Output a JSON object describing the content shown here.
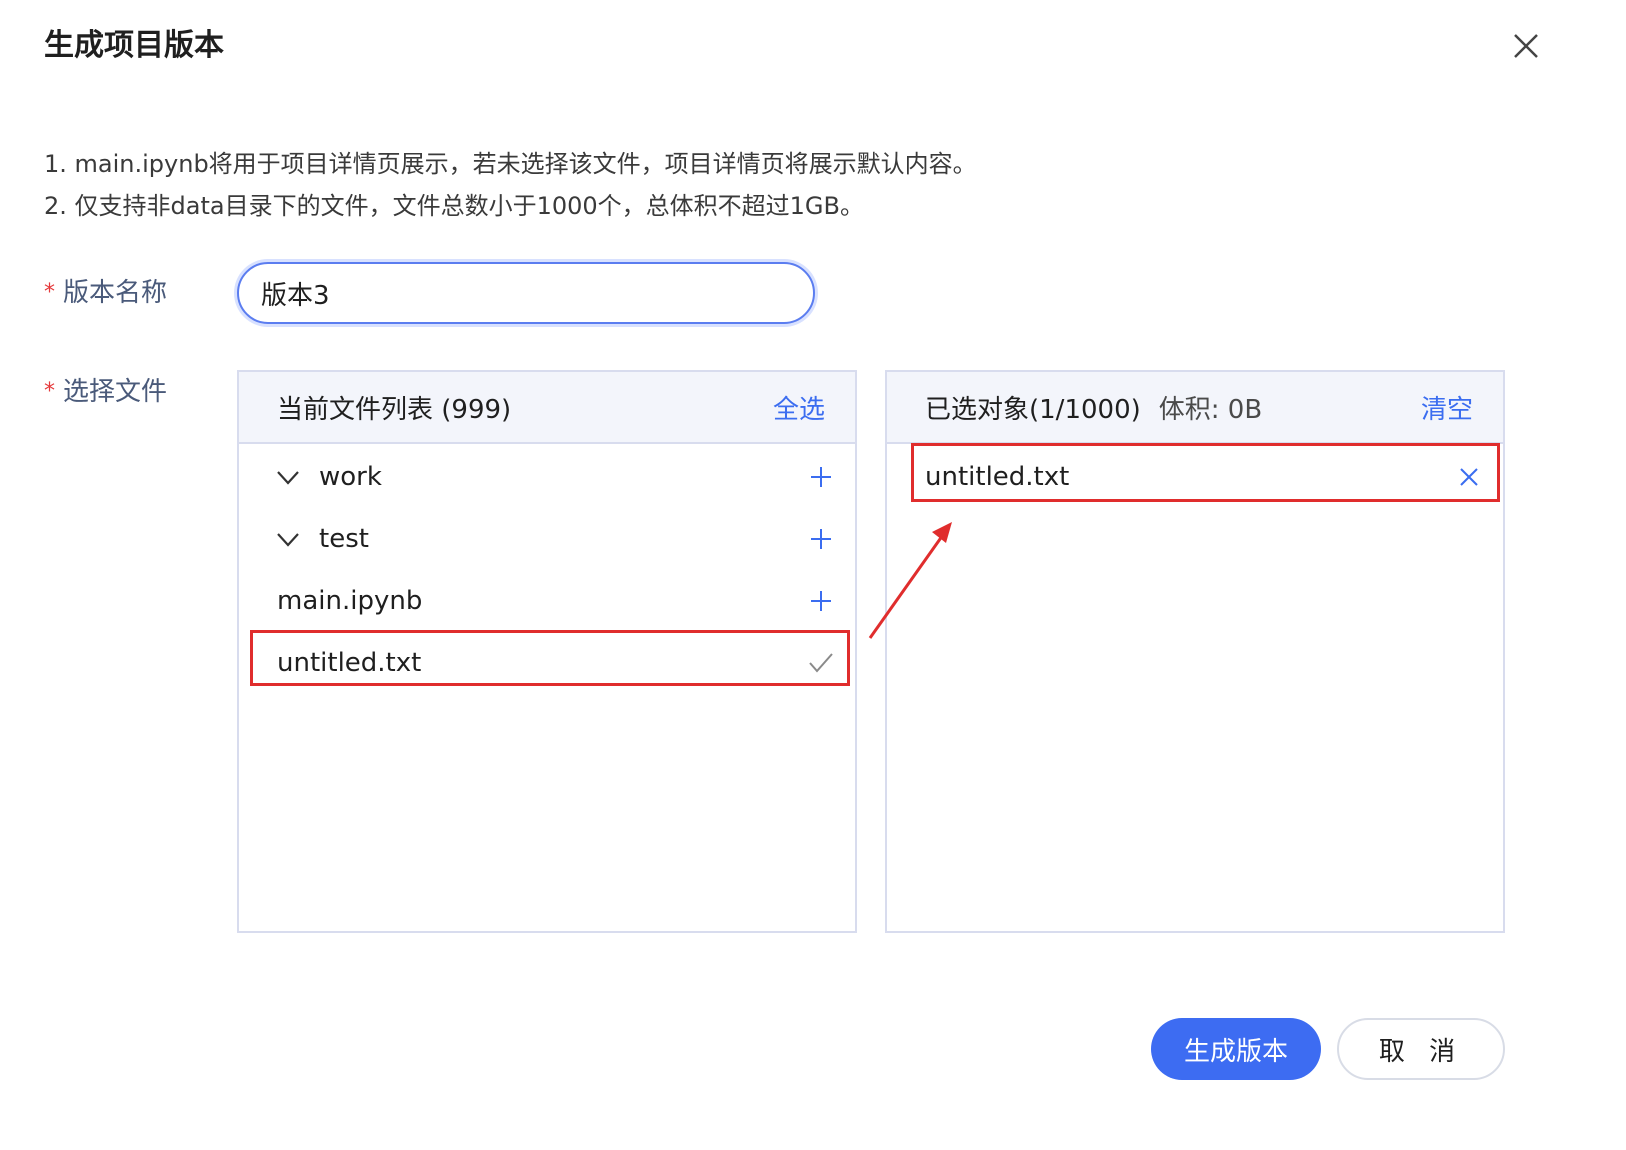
{
  "dialog": {
    "title": "生成项目版本",
    "notes": [
      "1. main.ipynb将用于项目详情页展示，若未选择该文件，项目详情页将展示默认内容。",
      "2. 仅支持非data目录下的文件，文件总数小于1000个，总体积不超过1GB。"
    ]
  },
  "form": {
    "required_mark": "*",
    "name_label": "版本名称",
    "name_value": "版本3",
    "file_label": "选择文件"
  },
  "left_panel": {
    "title": "当前文件列表 (999)",
    "select_all": "全选",
    "items": [
      {
        "name": "work",
        "type": "folder",
        "icon": "plus-icon"
      },
      {
        "name": "test",
        "type": "folder",
        "icon": "plus-icon"
      },
      {
        "name": "main.ipynb",
        "type": "file",
        "icon": "plus-icon"
      },
      {
        "name": "untitled.txt",
        "type": "file",
        "icon": "check-icon"
      }
    ]
  },
  "right_panel": {
    "title": "已选对象(1/1000)",
    "size": "体积: 0B",
    "clear": "清空",
    "items": [
      {
        "name": "untitled.txt",
        "icon": "close-icon"
      }
    ]
  },
  "buttons": {
    "submit": "生成版本",
    "cancel": "取 消"
  },
  "colors": {
    "accent": "#3d6cf2",
    "highlight": "#e02d2d",
    "required": "#e5393b"
  }
}
